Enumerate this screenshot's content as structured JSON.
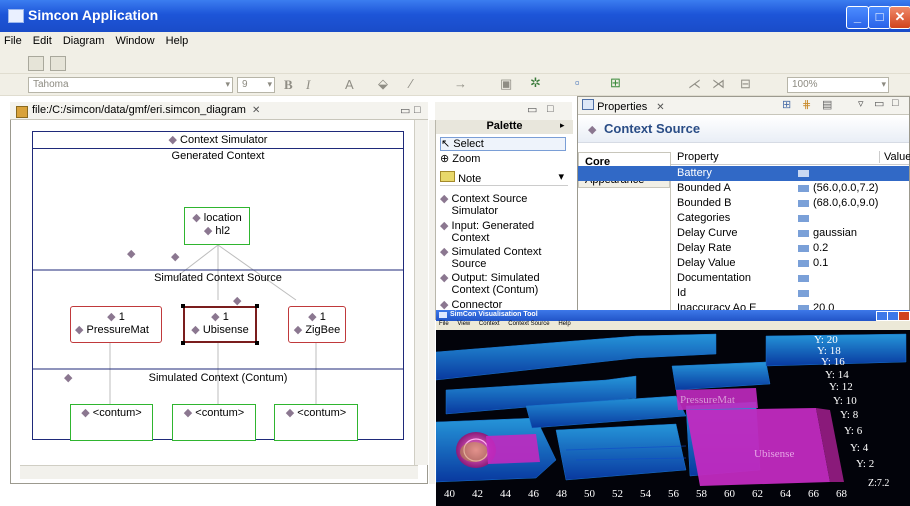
{
  "window": {
    "title": "Simcon Application",
    "minimize": "_",
    "maximize": "□",
    "close": "✕"
  },
  "menu": [
    "File",
    "Edit",
    "Diagram",
    "Window",
    "Help"
  ],
  "toolbar": {
    "font": "Tahoma",
    "size": "9",
    "bold": "B",
    "italic": "I",
    "text_color": "A",
    "zoom": "100%"
  },
  "editor": {
    "tab": "file:/C:/simcon/data/gmf/eri.simcon_diagram",
    "context_simulator": "Context Simulator",
    "generated_context": "Generated Context",
    "location": "location",
    "hl2": "hl2",
    "simulated_context_source": "Simulated Context Source",
    "sources": [
      {
        "count": "1",
        "name": "PressureMat"
      },
      {
        "count": "1",
        "name": "Ubisense"
      },
      {
        "count": "1",
        "name": "ZigBee"
      }
    ],
    "simulated_context_contum": "Simulated Context (Contum)",
    "contums": [
      "<contum>",
      "<contum>",
      "<contum>"
    ]
  },
  "palette": {
    "title": "Palette",
    "select": "Select",
    "zoom": "Zoom",
    "note": "Note",
    "items": [
      [
        "Context Source",
        "Simulator"
      ],
      [
        "Input: Generated",
        "Context"
      ],
      [
        "Simulated Context",
        "Source"
      ],
      [
        "Output: Simulated",
        "Context (Contum)"
      ],
      [
        "Connector"
      ]
    ]
  },
  "properties": {
    "tab": "Properties",
    "header": "Context Source",
    "side_tabs": [
      "Core",
      "Appearance"
    ],
    "col_property": "Property",
    "col_value": "Value",
    "rows": [
      {
        "property": "Battery",
        "value": ""
      },
      {
        "property": "Bounded A",
        "value": "(56.0,0.0,7.2)"
      },
      {
        "property": "Bounded B",
        "value": "(68.0,6.0,9.0)"
      },
      {
        "property": "Categories",
        "value": ""
      },
      {
        "property": "Delay Curve",
        "value": "gaussian"
      },
      {
        "property": "Delay Rate",
        "value": "0.2"
      },
      {
        "property": "Delay Value",
        "value": "0.1"
      },
      {
        "property": "Documentation",
        "value": ""
      },
      {
        "property": "Id",
        "value": ""
      },
      {
        "property": "Inaccuracy Ao E",
        "value": "20.0"
      }
    ]
  },
  "visualisation": {
    "title": "SimCon Visualisation Tool",
    "menu": [
      "File",
      "View",
      "Context",
      "Context Source",
      "Help"
    ],
    "x_ticks": [
      "40",
      "42",
      "44",
      "46",
      "48",
      "50",
      "52",
      "54",
      "56",
      "58",
      "60",
      "62",
      "64",
      "66",
      "68"
    ],
    "y_ticks": [
      "Y: 20",
      "Y: 18",
      "Y: 16",
      "Y: 14",
      "Y: 12",
      "Y: 10",
      "Y: 8",
      "Y: 6",
      "Y: 4",
      "Y: 2"
    ],
    "z_label": "Z:7.2",
    "region_labels": [
      "PressureMat",
      "Ubisense"
    ]
  },
  "colors": {
    "title_blue": "#1d55d8",
    "diagram_blue": "#1f2a7a",
    "green": "#2fb52f",
    "red": "#c0393b",
    "magenta": "#d13bd1",
    "cyan": "#22b7e6"
  }
}
